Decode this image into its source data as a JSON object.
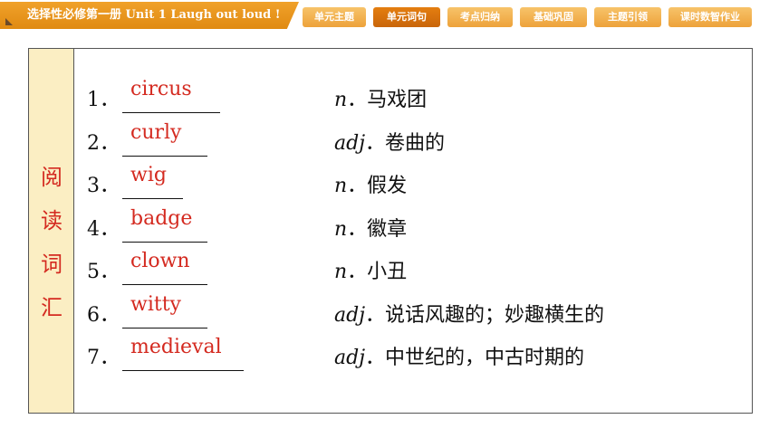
{
  "header": {
    "title": "选择性必修第一册  Unit 1  Laugh out loud !",
    "tabs": [
      {
        "label": "单元主题",
        "active": false
      },
      {
        "label": "单元词句",
        "active": true
      },
      {
        "label": "考点归纳",
        "active": false
      },
      {
        "label": "基础巩固",
        "active": false
      },
      {
        "label": "主题引领",
        "active": false
      },
      {
        "label": "课时数智作业",
        "active": false
      }
    ]
  },
  "section": {
    "side_label": [
      "阅",
      "读",
      "词",
      "汇"
    ]
  },
  "vocab": [
    {
      "num": "1．",
      "answer": "circus",
      "pos": "n",
      "meaning": "．马戏团"
    },
    {
      "num": "2．",
      "answer": "curly",
      "pos": "adj",
      "meaning": "．卷曲的"
    },
    {
      "num": "3．",
      "answer": "wig",
      "pos": "n",
      "meaning": "．假发"
    },
    {
      "num": "4．",
      "answer": "badge",
      "pos": "n",
      "meaning": "．徽章"
    },
    {
      "num": "5．",
      "answer": "clown",
      "pos": "n",
      "meaning": "．小丑"
    },
    {
      "num": "6．",
      "answer": "witty",
      "pos": "adj",
      "meaning": "．说话风趣的；妙趣横生的"
    },
    {
      "num": "7．",
      "answer": "medieval",
      "pos": "adj",
      "meaning": "．中世纪的，中古时期的"
    }
  ],
  "colors": {
    "accent_orange": "#e08a12",
    "answer_red": "#d42a20",
    "side_fill": "#fbeec3"
  }
}
